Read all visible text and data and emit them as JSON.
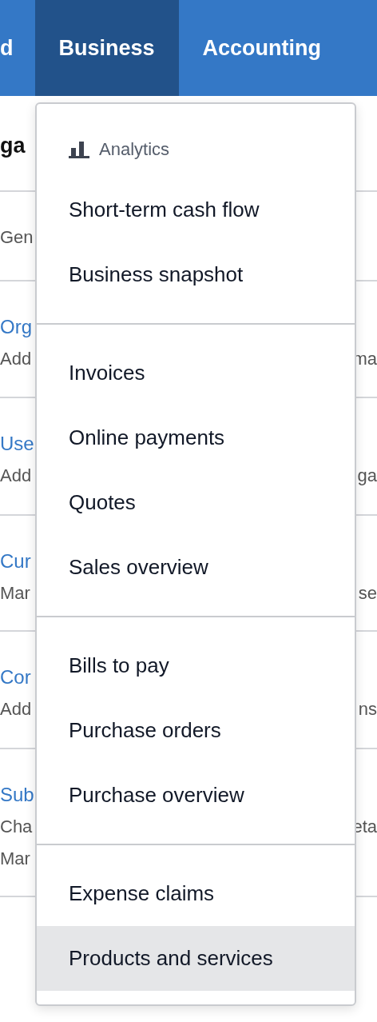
{
  "nav": {
    "tabs": [
      {
        "label": "d",
        "selected": false
      },
      {
        "label": "Business",
        "selected": true
      },
      {
        "label": "Accounting",
        "selected": false
      }
    ]
  },
  "page": {
    "heading": "ga",
    "rows": [
      {
        "lines": [
          {
            "kind": "desc",
            "text": "Gen"
          }
        ]
      },
      {
        "lines": [
          {
            "kind": "title",
            "text": "Org"
          },
          {
            "kind": "desc",
            "text": "Add"
          }
        ],
        "right": "ma"
      },
      {
        "lines": [
          {
            "kind": "title",
            "text": "Use"
          },
          {
            "kind": "desc",
            "text": "Add"
          }
        ],
        "right": "ga"
      },
      {
        "lines": [
          {
            "kind": "title",
            "text": "Cur"
          },
          {
            "kind": "desc",
            "text": "Mar"
          }
        ],
        "right": "se"
      },
      {
        "lines": [
          {
            "kind": "title",
            "text": "Cor"
          },
          {
            "kind": "desc",
            "text": "Add"
          }
        ],
        "right": "ns"
      },
      {
        "lines": [
          {
            "kind": "title",
            "text": "Sub"
          },
          {
            "kind": "desc",
            "text": "Cha"
          },
          {
            "kind": "desc",
            "text": "Mar"
          }
        ],
        "right": "eta"
      }
    ]
  },
  "menu": {
    "sections": [
      {
        "header": "Analytics",
        "items": [
          {
            "label": "Short-term cash flow",
            "selected": false
          },
          {
            "label": "Business snapshot",
            "selected": false
          }
        ]
      },
      {
        "items": [
          {
            "label": "Invoices",
            "selected": false
          },
          {
            "label": "Online payments",
            "selected": false
          },
          {
            "label": "Quotes",
            "selected": false
          },
          {
            "label": "Sales overview",
            "selected": false
          }
        ]
      },
      {
        "items": [
          {
            "label": "Bills to pay",
            "selected": false
          },
          {
            "label": "Purchase orders",
            "selected": false
          },
          {
            "label": "Purchase overview",
            "selected": false
          }
        ]
      },
      {
        "items": [
          {
            "label": "Expense claims",
            "selected": false
          },
          {
            "label": "Products and services",
            "selected": true
          }
        ]
      }
    ]
  }
}
